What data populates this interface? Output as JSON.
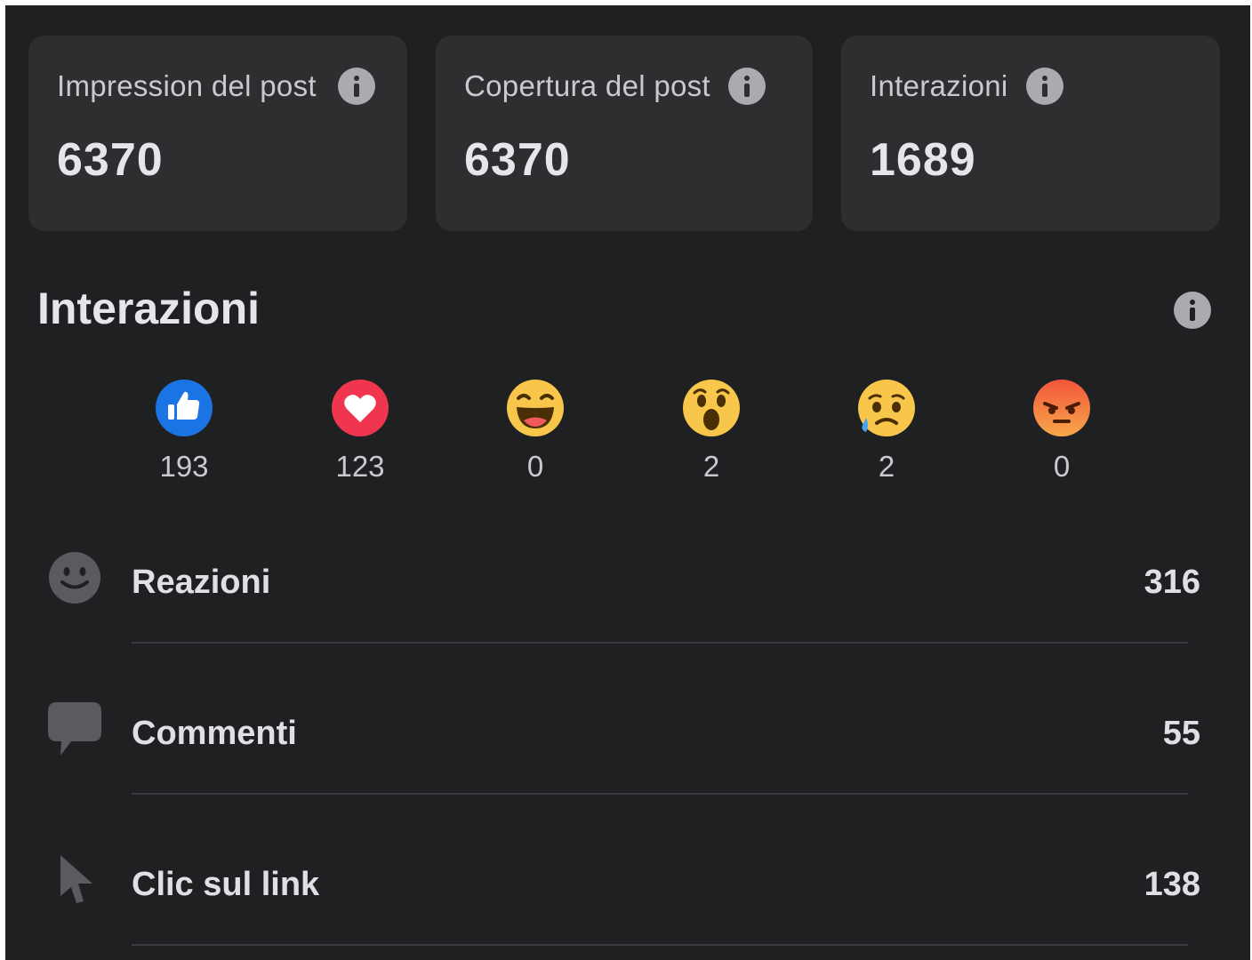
{
  "cards": [
    {
      "label": "Impression del post",
      "value": "6370"
    },
    {
      "label": "Copertura del post",
      "value": "6370"
    },
    {
      "label": "Interazioni",
      "value": "1689"
    }
  ],
  "section": {
    "title": "Interazioni"
  },
  "reactions": [
    {
      "icon": "like-reaction-icon",
      "count": "193"
    },
    {
      "icon": "love-reaction-icon",
      "count": "123"
    },
    {
      "icon": "haha-reaction-icon",
      "count": "0"
    },
    {
      "icon": "wow-reaction-icon",
      "count": "2"
    },
    {
      "icon": "sad-reaction-icon",
      "count": "2"
    },
    {
      "icon": "angry-reaction-icon",
      "count": "0"
    }
  ],
  "rows": [
    {
      "icon": "smiley-icon",
      "label": "Reazioni",
      "value": "316"
    },
    {
      "icon": "comment-bubble-icon",
      "label": "Commenti",
      "value": "55"
    },
    {
      "icon": "cursor-pointer-icon",
      "label": "Clic sul link",
      "value": "138"
    }
  ],
  "colors": {
    "background": "#1f2022",
    "card": "#2d2e30",
    "text": "#e4e6eb",
    "muted": "#a9abb0"
  }
}
